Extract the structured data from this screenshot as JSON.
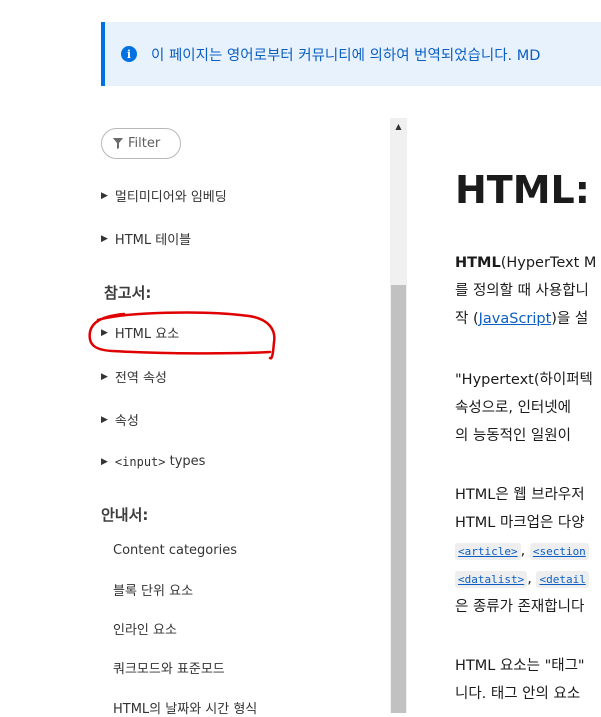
{
  "banner": {
    "icon": "info-icon",
    "text": "이 페이지는 영어로부터 커뮤니티에 의하여 번역되었습니다. MD"
  },
  "sidebar": {
    "filter_label": "Filter",
    "items_top": [
      {
        "label": "멀티미디어와 임베딩"
      },
      {
        "label": "HTML 테이블"
      }
    ],
    "reference_heading": "참고서:",
    "reference_items": [
      {
        "label": "HTML 요소"
      },
      {
        "label": "전역 속성"
      },
      {
        "label": "속성"
      },
      {
        "label_code": "<input>",
        "label_rest": " types"
      }
    ],
    "guide_heading": "안내서:",
    "guide_items": [
      {
        "label": "Content categories"
      },
      {
        "label": "블록 단위 요소"
      },
      {
        "label": "인라인 요소"
      },
      {
        "label": "쿼크모드와 표준모드"
      },
      {
        "label": "HTML의 날짜와 시간 형식"
      }
    ]
  },
  "main": {
    "title": "HTML: H",
    "para1": {
      "line1_bold": "HTML",
      "line1_rest": "(HyperText M",
      "line2": "를 정의할 때 사용합니",
      "line3_pre": "작 (",
      "line3_link": "JavaScript",
      "line3_post": ")을 설"
    },
    "para2": {
      "line1": "\"Hypertext(하이퍼텍",
      "line2": "속성으로, 인터넷에 ",
      "line3": "의 능동적인 일원이 "
    },
    "para3": {
      "line1": "HTML은 웹 브라우저",
      "line2": "HTML 마크업은 다양",
      "codes_row1": [
        "<article>",
        "<section"
      ],
      "codes_row2": [
        "<datalist>",
        "<detail"
      ],
      "line5": "은 종류가 존재합니다"
    },
    "para4": {
      "line1": "HTML 요소는 \"태그\"",
      "line2": "니다. 태그 안의 요소"
    }
  },
  "annotation": {
    "color": "#e00000"
  }
}
